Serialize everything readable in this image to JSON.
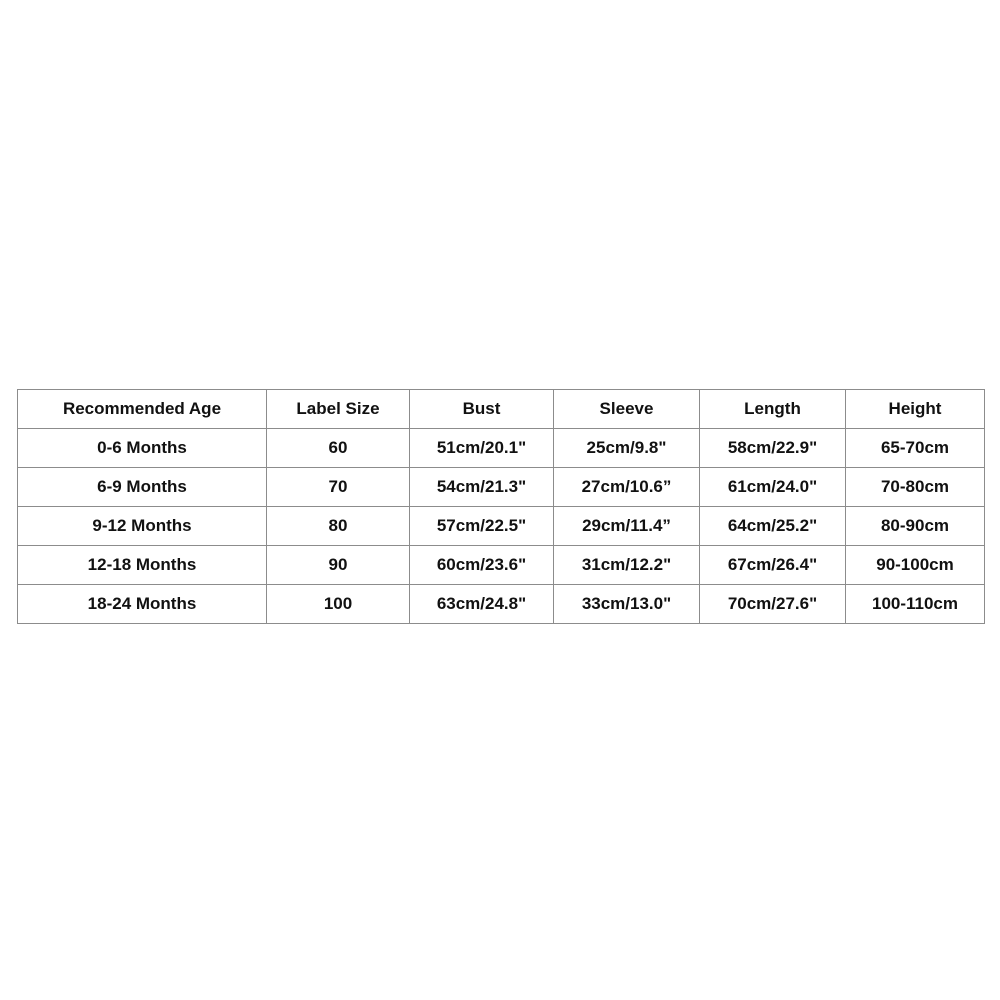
{
  "size_chart": {
    "headers": [
      "Recommended Age",
      "Label Size",
      "Bust",
      "Sleeve",
      "Length",
      "Height"
    ],
    "rows": [
      [
        "0-6 Months",
        "60",
        "51cm/20.1\"",
        "25cm/9.8\"",
        "58cm/22.9\"",
        "65-70cm"
      ],
      [
        "6-9 Months",
        "70",
        "54cm/21.3\"",
        "27cm/10.6”",
        "61cm/24.0\"",
        "70-80cm"
      ],
      [
        "9-12 Months",
        "80",
        "57cm/22.5\"",
        "29cm/11.4”",
        "64cm/25.2\"",
        "80-90cm"
      ],
      [
        "12-18 Months",
        "90",
        "60cm/23.6\"",
        "31cm/12.2\"",
        "67cm/26.4\"",
        "90-100cm"
      ],
      [
        "18-24 Months",
        "100",
        "63cm/24.8\"",
        "33cm/13.0\"",
        "70cm/27.6\"",
        "100-110cm"
      ]
    ]
  }
}
